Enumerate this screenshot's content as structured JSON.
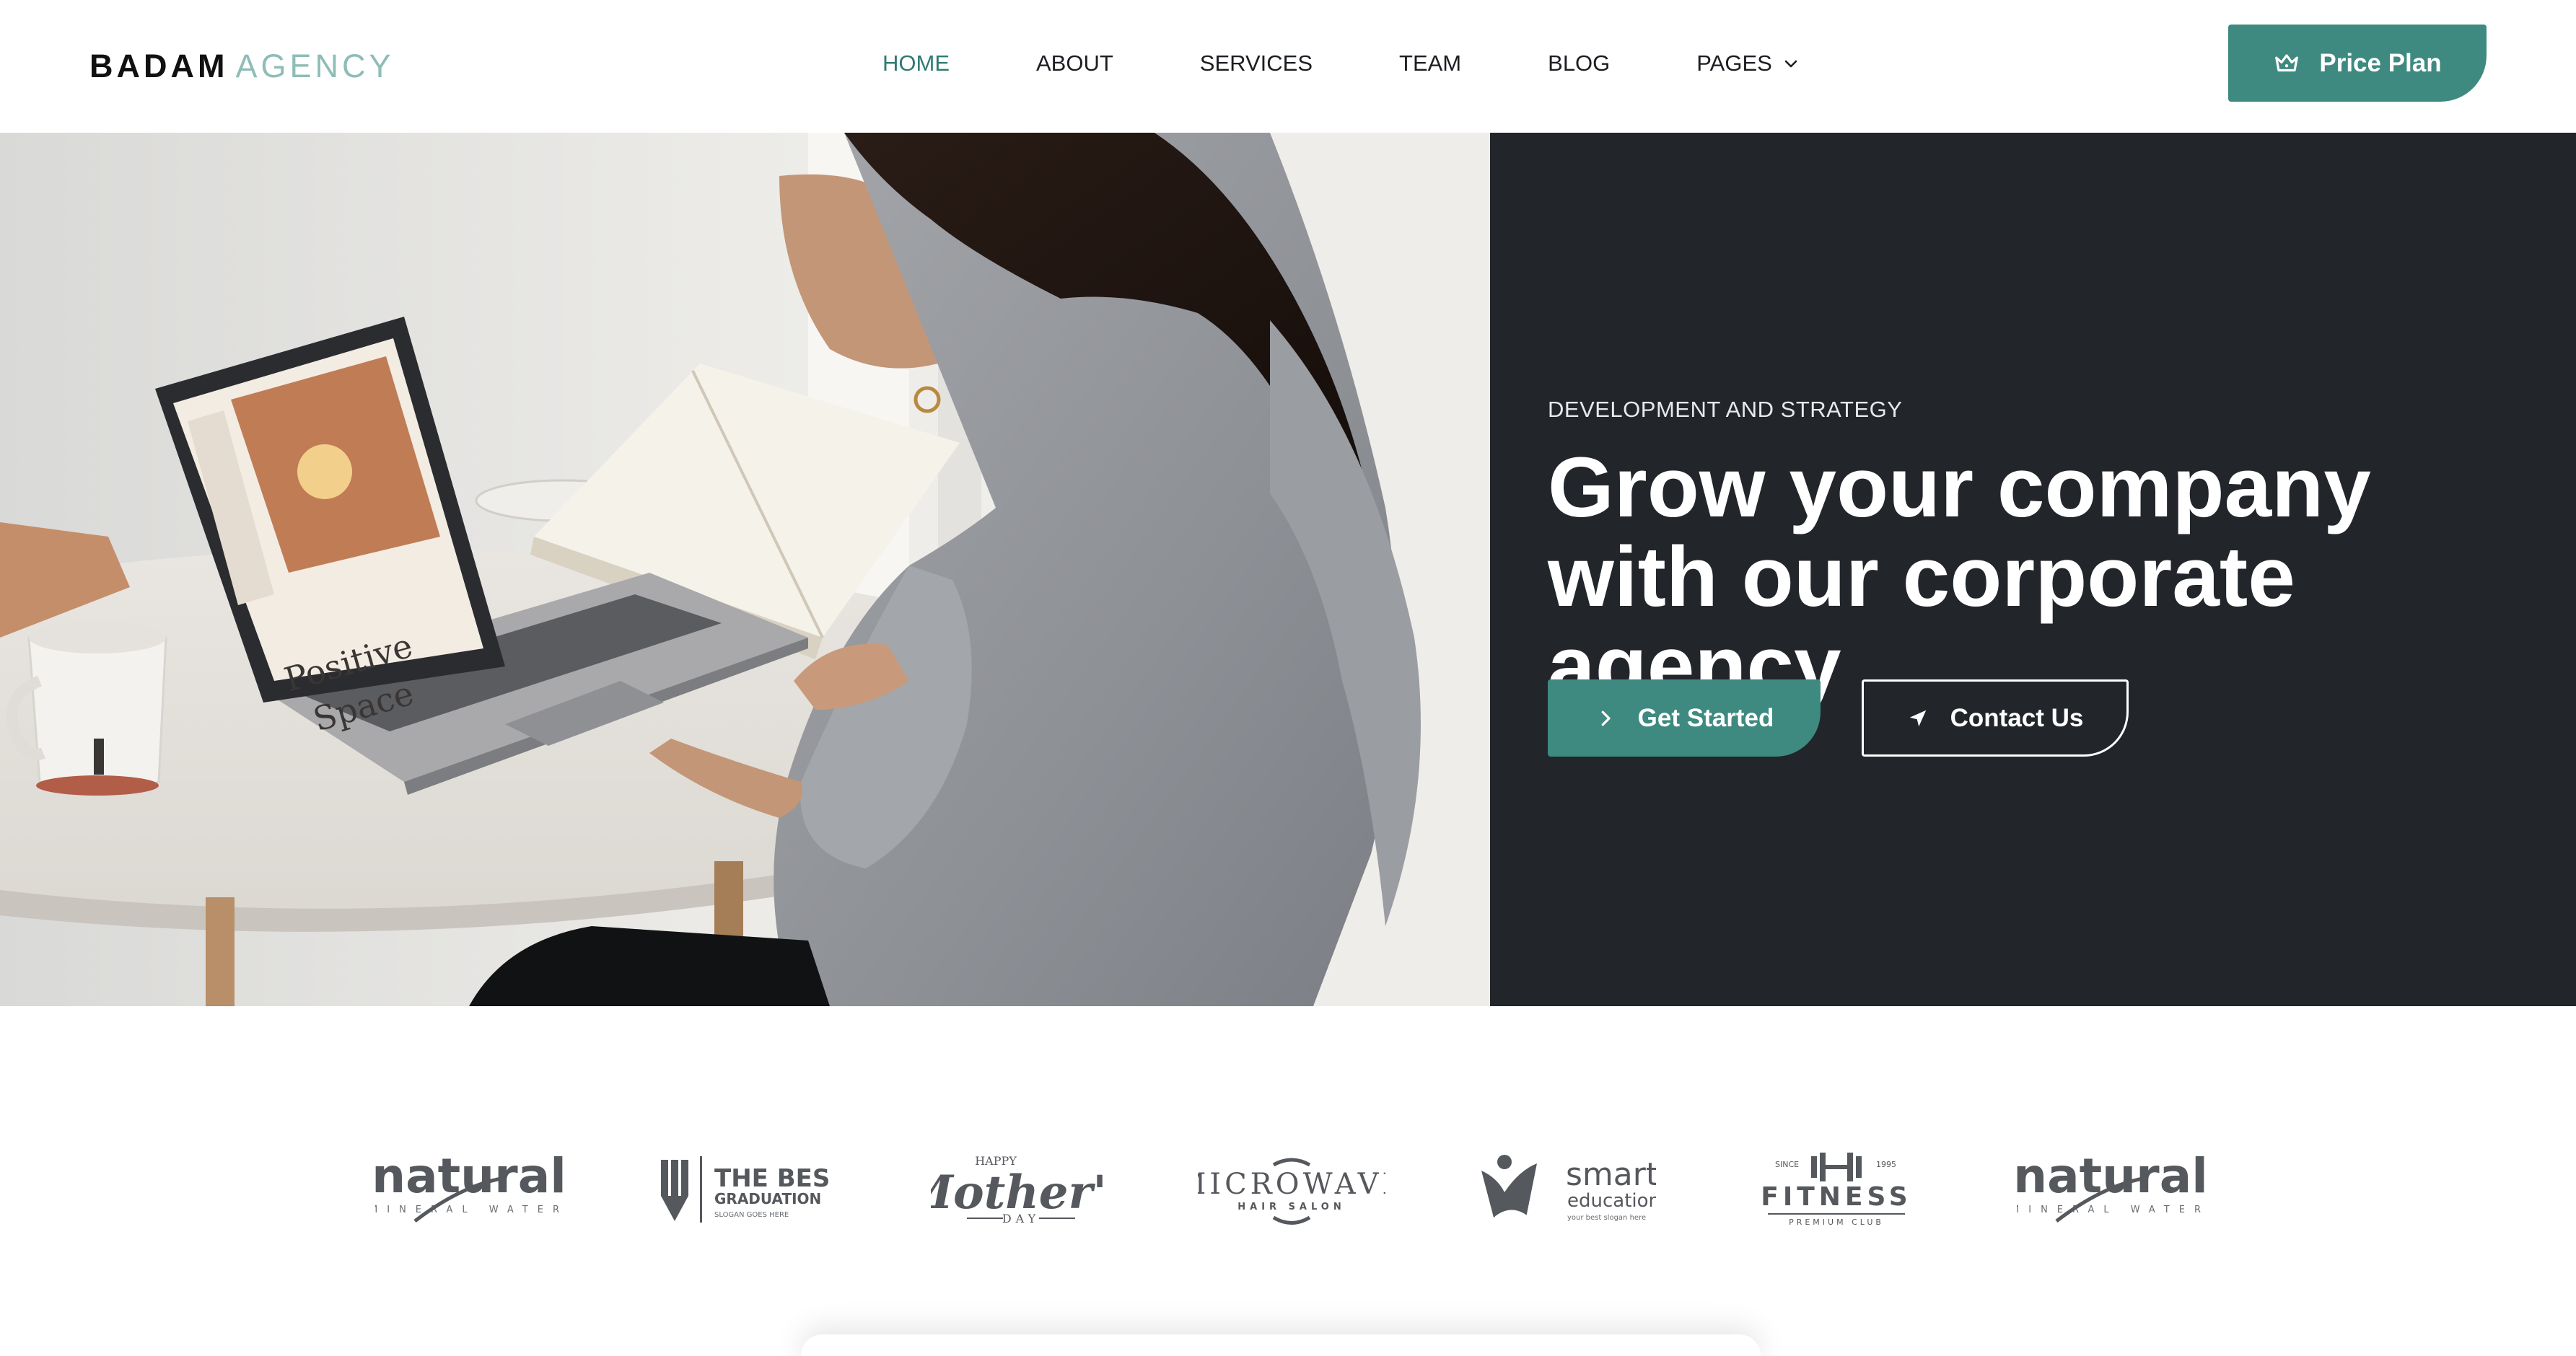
{
  "header": {
    "logo_bold": "BADAM",
    "logo_light": "AGENCY",
    "nav": [
      {
        "label": "HOME",
        "active": true
      },
      {
        "label": "ABOUT",
        "active": false
      },
      {
        "label": "SERVICES",
        "active": false
      },
      {
        "label": "TEAM",
        "active": false
      },
      {
        "label": "BLOG",
        "active": false
      },
      {
        "label": "PAGES",
        "active": false,
        "dropdown": true
      }
    ],
    "cta": {
      "label": "Price Plan",
      "icon": "crown-icon"
    }
  },
  "hero": {
    "eyebrow": "DEVELOPMENT AND STRATEGY",
    "title": "Grow your company with our corporate agency",
    "primary_button": {
      "label": "Get Started",
      "icon": "chevron-right-icon"
    },
    "secondary_button": {
      "label": "Contact Us",
      "icon": "paper-plane-icon"
    },
    "image_alt": "Woman working on a laptop at a table"
  },
  "clients": [
    {
      "name": "natural",
      "sub": "MINERAL WATER"
    },
    {
      "name": "THE BEST",
      "sub": "GRADUATION",
      "tagline": "SLOGAN GOES HERE"
    },
    {
      "name": "Mother's",
      "pre": "HAPPY",
      "sub": "DAY"
    },
    {
      "name": "MICROWAVE",
      "sub": "HAIR SALON"
    },
    {
      "name": "smart",
      "sub": "education",
      "tagline": "your best slogan here"
    },
    {
      "name": "FITNESS",
      "pre_left": "SINCE",
      "pre_right": "1995",
      "sub": "PREMIUM CLUB"
    },
    {
      "name": "natural",
      "sub": "MINERAL WATER"
    }
  ],
  "colors": {
    "accent": "#3e8a80",
    "dark_panel": "#22252a",
    "logo_light": "#8ebdb7",
    "nav_active": "#2f7a72"
  }
}
